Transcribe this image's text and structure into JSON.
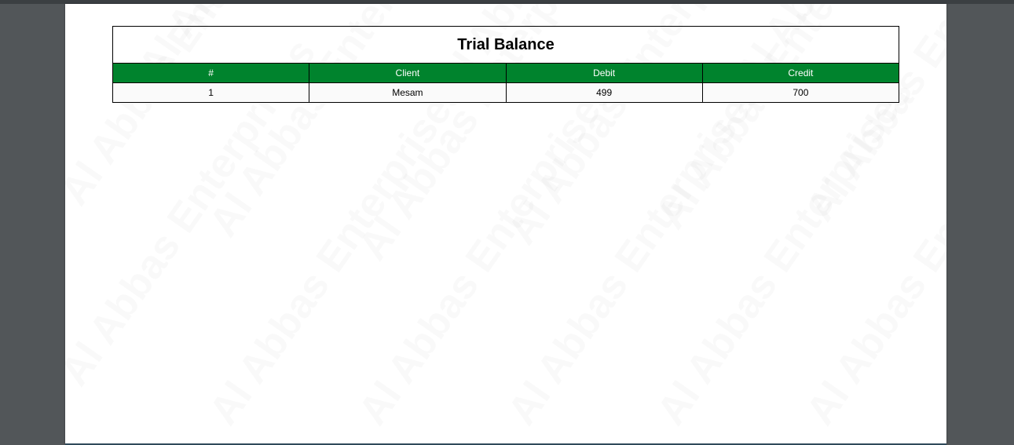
{
  "report": {
    "title": "Trial Balance",
    "watermark": "Al Abbas Enterprises",
    "columns": [
      "#",
      "Client",
      "Debit",
      "Credit"
    ],
    "rows": [
      [
        "1",
        "Mesam",
        "499",
        "700"
      ]
    ]
  },
  "colors": {
    "header_bg": "#00832d",
    "header_text": "#ffffff",
    "viewer_bg": "#525659"
  }
}
